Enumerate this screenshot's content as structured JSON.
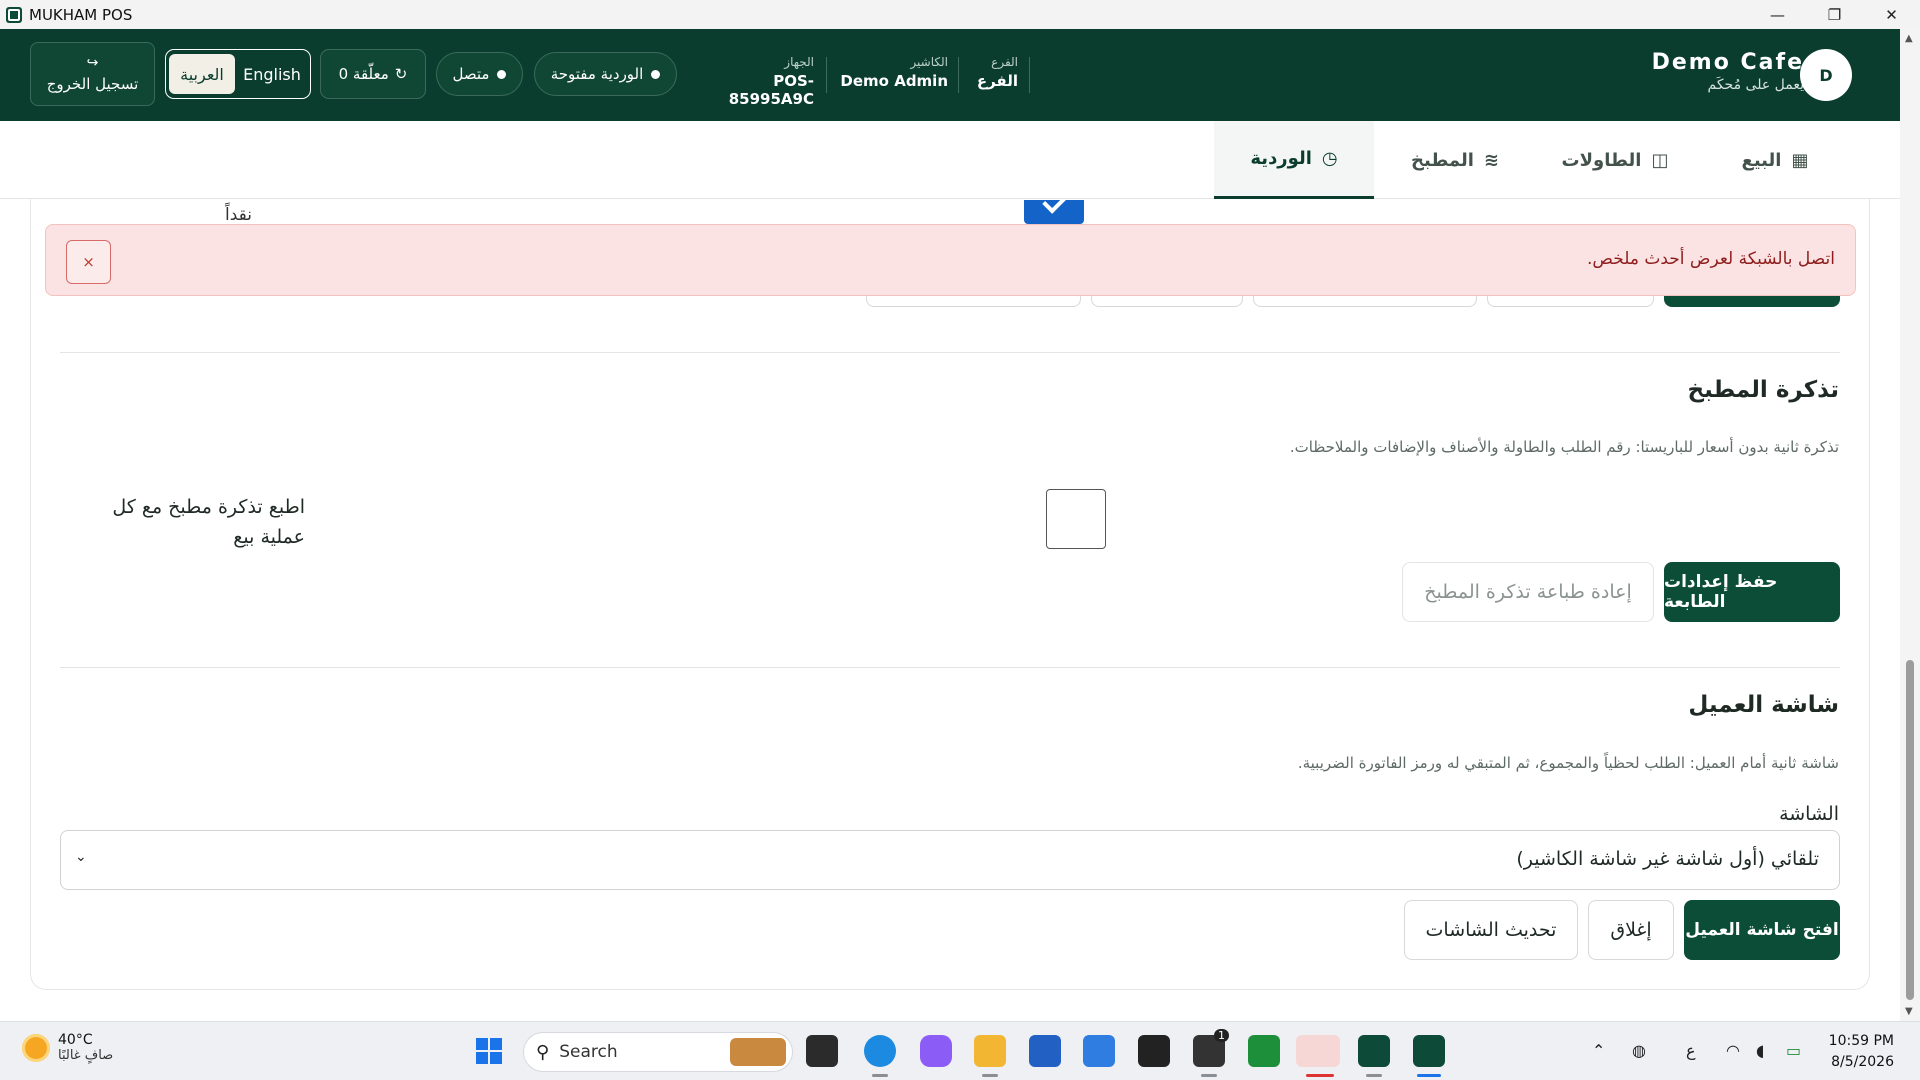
{
  "window": {
    "title": "MUKHAM POS",
    "controls": [
      "—",
      "❐",
      "✕"
    ]
  },
  "header": {
    "logout_label": "تسجيل الخروج",
    "lang_ar": "العربية",
    "lang_en": "English",
    "pending_label": "0 معلّقة",
    "online_label": "متصل",
    "shift_label": "الوردية مفتوحة",
    "device_label": "الجهاز",
    "device_value": "POS-85995A9C",
    "cashier_label": "الكاشير",
    "cashier_value": "Demo Admin",
    "branch_label": "الفرع",
    "branch_value": "الفرع",
    "brand_name": "Demo Cafe",
    "brand_sub": "يعمل على مُحكَم",
    "avatar_initial": "D"
  },
  "tabs": [
    {
      "label": "البيع",
      "icon": "grid-icon"
    },
    {
      "label": "الطاولات",
      "icon": "tables-icon"
    },
    {
      "label": "المطبخ",
      "icon": "kitchen-icon"
    },
    {
      "label": "الوردية",
      "icon": "clock-icon",
      "active": true
    }
  ],
  "content": {
    "partial_text": "نقداً",
    "alert_message": "اتصل بالشبكة لعرض أحدث ملخص.",
    "alert_close": "×",
    "kitchen": {
      "title": "تذكرة المطبخ",
      "description": "تذكرة ثانية بدون أسعار للباريستا: رقم الطلب والطاولة والأصناف والإضافات والملاحظات.",
      "checkbox_label": "اطبع تذكرة مطبخ مع كل عملية بيع",
      "save_button": "حفظ إعدادات الطابعة",
      "reprint_button": "إعادة طباعة تذكرة المطبخ"
    },
    "customer_display": {
      "title": "شاشة العميل",
      "description": "شاشة ثانية أمام العميل: الطلب لحظياً والمجموع، ثم المتبقي له ورمز الفاتورة الضريبية.",
      "field_label": "الشاشة",
      "select_value": "تلقائي (أول شاشة غير شاشة الكاشير)",
      "open_button": "افتح شاشة العميل",
      "close_button": "إغلاق",
      "refresh_button": "تحديث الشاشات"
    }
  },
  "taskbar": {
    "temperature": "40°C",
    "weather_desc": "صافٍ غالبًا",
    "search_placeholder": "Search",
    "badge_count": "1",
    "input_lang": "ع",
    "time": "10:59 PM",
    "date": "8/5/2026"
  },
  "colors": {
    "brand": "#0a3d2e",
    "alert_bg": "#fae3e2",
    "alert_text": "#8f1d1d"
  }
}
